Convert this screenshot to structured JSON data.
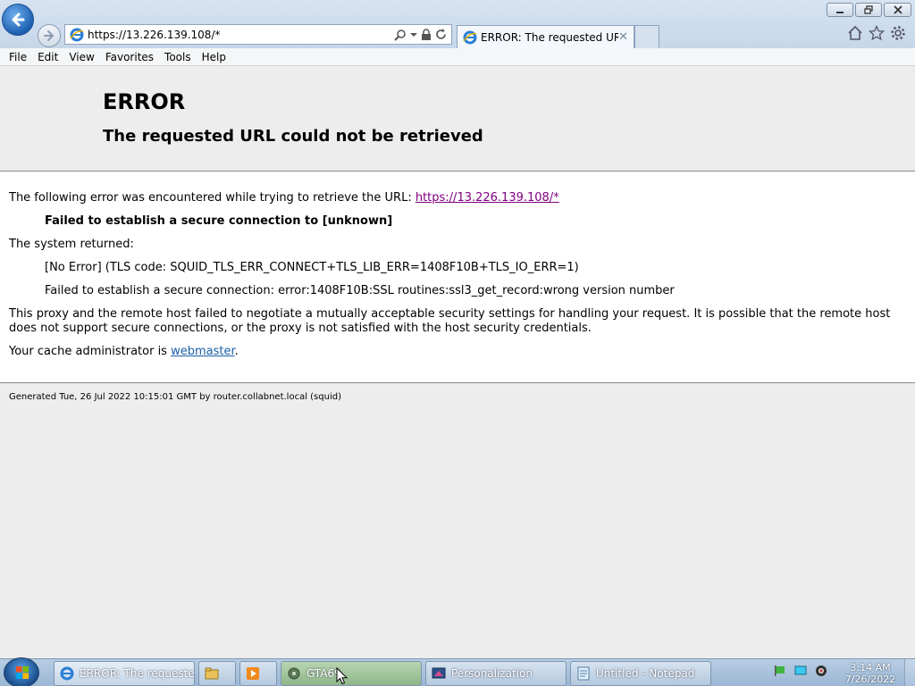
{
  "browser": {
    "address_url": "https://13.226.139.108/*",
    "tab_title": "ERROR: The requested URL c..."
  },
  "menu": [
    "File",
    "Edit",
    "View",
    "Favorites",
    "Tools",
    "Help"
  ],
  "page": {
    "title": "ERROR",
    "subtitle": "The requested URL could not be retrieved",
    "intro_text": "The following error was encountered while trying to retrieve the URL: ",
    "intro_link": "https://13.226.139.108/*",
    "failed_msg": "Failed to establish a secure connection to [unknown]",
    "system_returned": "The system returned:",
    "tls_code": "[No Error] (TLS code: SQUID_TLS_ERR_CONNECT+TLS_LIB_ERR=1408F10B+TLS_IO_ERR=1)",
    "ssl_error": "Failed to establish a secure connection: error:1408F10B:SSL routines:ssl3_get_record:wrong version number",
    "explanation": "This proxy and the remote host failed to negotiate a mutually acceptable security settings for handling your request. It is possible that the remote host does not support secure connections, or the proxy is not satisfied with the host security credentials.",
    "admin_prefix": "Your cache administrator is ",
    "admin_link": "webmaster",
    "admin_suffix": ".",
    "generated": "Generated Tue, 26 Jul 2022 10:15:01 GMT by router.collabnet.local (squid)"
  },
  "taskbar": {
    "tasks": [
      {
        "label": "ERROR: The requeste...",
        "icon": "ie-icon"
      },
      {
        "label": "",
        "icon": "explorer-icon"
      },
      {
        "label": "",
        "icon": "media-player-icon"
      },
      {
        "label": "GTA69",
        "icon": "gta-icon"
      },
      {
        "label": "Personalization",
        "icon": "personalization-icon"
      },
      {
        "label": "Untitled - Notepad",
        "icon": "notepad-icon"
      }
    ],
    "clock_time": "3:14 AM",
    "clock_date": "7/26/2022"
  },
  "colors": {
    "link_visited": "#800080",
    "link": "#1a5fa8",
    "taskbar": "#9bb7d4"
  }
}
